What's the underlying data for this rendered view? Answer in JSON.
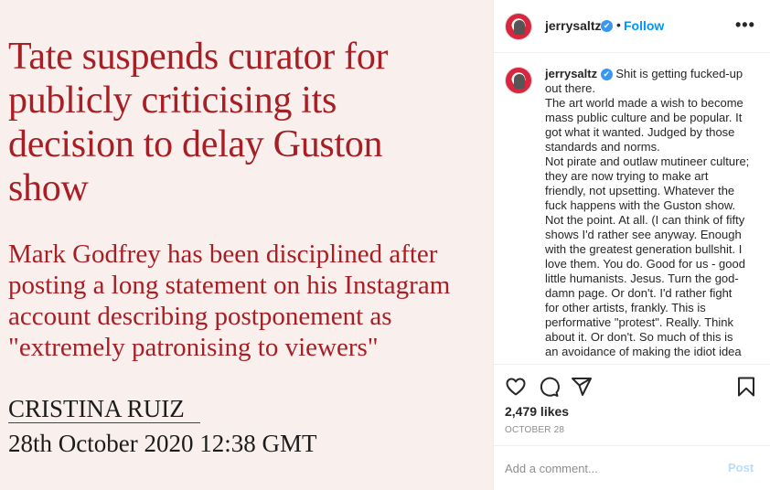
{
  "image_post": {
    "headline_lines": [
      "Tate suspends curator for",
      "publicly criticising its",
      "decision to delay Guston",
      "show"
    ],
    "standfirst_lines": [
      "Mark Godfrey has been disciplined after",
      "posting a long statement on his Instagram",
      "account describing postponement as",
      "\"extremely patronising to viewers\""
    ],
    "byline": "CRISTINA RUIZ",
    "dateline": "28th October 2020 12:38 GMT",
    "headline_color": "#a71e24",
    "background_color": "#f9efed"
  },
  "header": {
    "username": "jerrysaltz",
    "verified_icon": "✔",
    "separator": "•",
    "follow_label": "Follow",
    "more_label": "•••"
  },
  "caption": {
    "username": "jerrysaltz",
    "verified_icon": "✔",
    "first_line": "Shit is getting fucked-up",
    "lines": [
      "out there.",
      "The art world made a wish to become",
      "mass public culture and be popular. It",
      "got what it wanted. Judged by those",
      "standards and norms.",
      "Not pirate and outlaw mutineer culture;",
      "they are now trying to make art",
      "friendly, not upsetting. Whatever the",
      "fuck happens with the Guston show.",
      "Not the point. At all. (I can think of fifty",
      "shows I'd rather see anyway. Enough",
      "with the greatest generation bullshit. I",
      "love them. You do. Good for us - good",
      "little humanists. Jesus. Turn the god-",
      "damn page. Or don't. I'd rather fight",
      "for other artists, frankly. This is",
      "performative \"protest\". Really. Think",
      "about it. Or don't. So much of this is",
      "an avoidance of making the idiot idea"
    ]
  },
  "actions": {
    "likes": "2,479 likes",
    "date": "OCTOBER 28",
    "icons": [
      "heart-icon",
      "comment-icon",
      "share-icon",
      "bookmark-icon"
    ]
  },
  "comment_box": {
    "placeholder": "Add a comment...",
    "post_label": "Post"
  },
  "colors": {
    "follow": "#0095f6",
    "post_disabled": "#b2dffc",
    "verified": "#3897f0"
  }
}
